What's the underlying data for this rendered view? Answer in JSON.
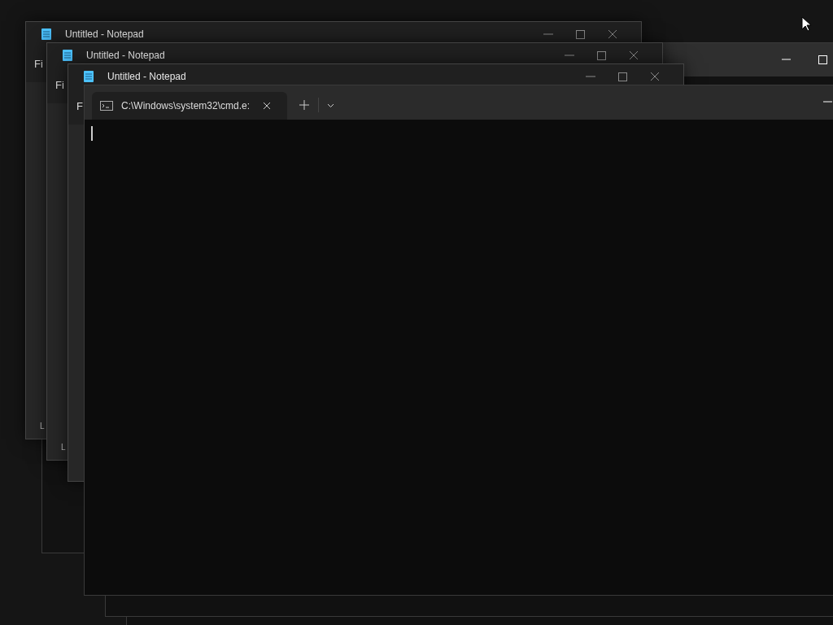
{
  "notepads": [
    {
      "title": "Untitled - Notepad",
      "menu_text": "Fi",
      "status_text": "L"
    },
    {
      "title": "Untitled - Notepad",
      "menu_text": "Fi",
      "status_text": "L"
    },
    {
      "title": "Untitled - Notepad",
      "menu_text": "F"
    }
  ],
  "terminal": {
    "tabs": [
      {
        "title": "C:\\Windows\\system32\\cmd.e:",
        "selected": true
      }
    ]
  }
}
